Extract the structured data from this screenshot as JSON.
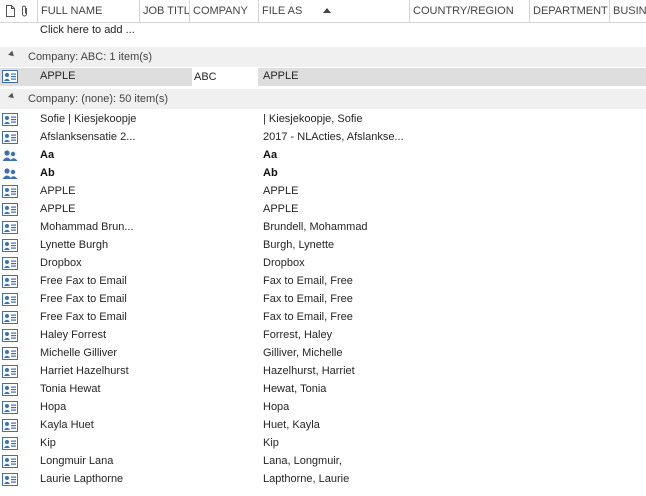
{
  "header": {
    "columns": [
      "FULL NAME",
      "JOB TITLE",
      "COMPANY",
      "FILE AS",
      "COUNTRY/REGION",
      "DEPARTMENT",
      "BUSINE"
    ],
    "sort_column": "FILE AS",
    "sort_direction": "ascending"
  },
  "add_row": {
    "label": "Click here to add ..."
  },
  "groups": [
    {
      "label": "Company: ABC: 1 item(s)",
      "rows": [
        {
          "icon": "contact-card-icon",
          "full_name": "APPLE",
          "company": "ABC",
          "file_as": "APPLE",
          "bold": false,
          "selected": true
        }
      ]
    },
    {
      "label": "Company: (none): 50 item(s)",
      "rows": [
        {
          "icon": "contact-card-icon",
          "full_name": "Sofie | Kiesjekoopje",
          "company": "",
          "file_as": "| Kiesjekoopje, Sofie",
          "bold": false
        },
        {
          "icon": "contact-card-icon",
          "full_name": "Afslanksensatie 2...",
          "company": "",
          "file_as": "2017 - NLActies, Afslankse...",
          "bold": false
        },
        {
          "icon": "contact-group-icon",
          "full_name": "Aa",
          "company": "",
          "file_as": "Aa",
          "bold": true
        },
        {
          "icon": "contact-group-icon",
          "full_name": "Ab",
          "company": "",
          "file_as": "Ab",
          "bold": true
        },
        {
          "icon": "contact-card-icon",
          "full_name": "APPLE",
          "company": "",
          "file_as": "APPLE",
          "bold": false
        },
        {
          "icon": "contact-card-icon",
          "full_name": "APPLE",
          "company": "",
          "file_as": "APPLE",
          "bold": false
        },
        {
          "icon": "contact-card-icon",
          "full_name": "Mohammad Brun...",
          "company": "",
          "file_as": "Brundell, Mohammad",
          "bold": false
        },
        {
          "icon": "contact-card-icon",
          "full_name": "Lynette Burgh",
          "company": "",
          "file_as": "Burgh, Lynette",
          "bold": false
        },
        {
          "icon": "contact-card-icon",
          "full_name": "Dropbox",
          "company": "",
          "file_as": "Dropbox",
          "bold": false
        },
        {
          "icon": "contact-card-icon",
          "full_name": "Free Fax to Email",
          "company": "",
          "file_as": "Fax to Email, Free",
          "bold": false
        },
        {
          "icon": "contact-card-icon",
          "full_name": "Free Fax to Email",
          "company": "",
          "file_as": "Fax to Email, Free",
          "bold": false
        },
        {
          "icon": "contact-card-icon",
          "full_name": "Free Fax to Email",
          "company": "",
          "file_as": "Fax to Email, Free",
          "bold": false
        },
        {
          "icon": "contact-card-icon",
          "full_name": "Haley Forrest",
          "company": "",
          "file_as": "Forrest, Haley",
          "bold": false
        },
        {
          "icon": "contact-card-icon",
          "full_name": "Michelle Gilliver",
          "company": "",
          "file_as": "Gilliver, Michelle",
          "bold": false
        },
        {
          "icon": "contact-card-icon",
          "full_name": "Harriet Hazelhurst",
          "company": "",
          "file_as": "Hazelhurst, Harriet",
          "bold": false
        },
        {
          "icon": "contact-card-icon",
          "full_name": "Tonia Hewat",
          "company": "",
          "file_as": "Hewat, Tonia",
          "bold": false
        },
        {
          "icon": "contact-card-icon",
          "full_name": "Hopa",
          "company": "",
          "file_as": "Hopa",
          "bold": false
        },
        {
          "icon": "contact-card-icon",
          "full_name": "Kayla Huet",
          "company": "",
          "file_as": "Huet, Kayla",
          "bold": false
        },
        {
          "icon": "contact-card-icon",
          "full_name": "Kip",
          "company": "",
          "file_as": "Kip",
          "bold": false
        },
        {
          "icon": "contact-card-icon",
          "full_name": "Longmuir Lana",
          "company": "",
          "file_as": "Lana, Longmuir,",
          "bold": false
        },
        {
          "icon": "contact-card-icon",
          "full_name": "Laurie Lapthorne",
          "company": "",
          "file_as": "Lapthorne, Laurie",
          "bold": false
        }
      ]
    }
  ],
  "colors": {
    "header_border": "#d4d4d4",
    "group_bg": "#f0f0f0",
    "selected_bg": "#dedede",
    "icon_blue": "#3d6fb5"
  }
}
